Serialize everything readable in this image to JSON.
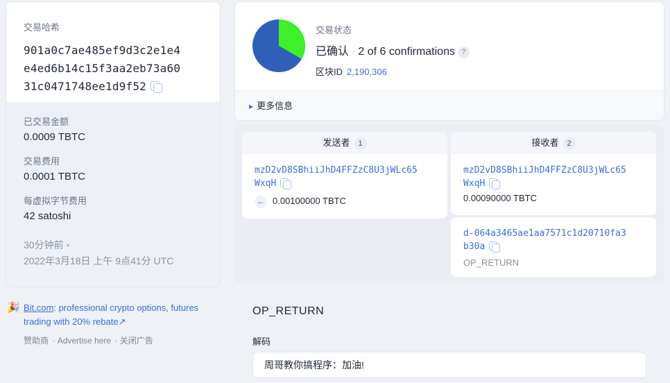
{
  "left": {
    "hash_label": "交易哈希",
    "hash_lines": [
      "901a0c7ae485ef9d3c2e1e4",
      "e4ed6b14c15f3aa2eb73a60",
      "31c0471748ee1d9f52"
    ],
    "traded_amount_label": "已交易金额",
    "traded_amount": "0.0009 TBTC",
    "fee_label": "交易费用",
    "fee": "0.0001 TBTC",
    "vbyte_fee_label": "每虚拟字节费用",
    "vbyte_fee": "42 satoshi",
    "time_ago": "30分钟前",
    "timestamp": "2022年3月18日 上午 9点41分 UTC"
  },
  "ad": {
    "brand_link": "Bit.com",
    "text_1": ": professional crypto options, futures",
    "text_2": "trading with 20% rebate",
    "sponsor": "赞助商",
    "advertise": "Advertise here",
    "close_ad": "关闭广告"
  },
  "status": {
    "label": "交易状态",
    "confirmed": "已确认",
    "confirmations": "2 of 6 confirmations",
    "block_label": "区块ID",
    "block_id": "2,190,306",
    "confirm_fraction": 0.3333,
    "more_info": "更多信息"
  },
  "io": {
    "senders_label": "发送者",
    "senders_count": "1",
    "receivers_label": "接收者",
    "receivers_count": "2",
    "sender": {
      "addr_1": "mzD2vD8SBhiiJhD4FFZzC8U3jWLc65",
      "addr_2": "WxqH",
      "amount": "0.00100000 TBTC"
    },
    "receiver_1": {
      "addr_1": "mzD2vD8SBhiiJhD4FFZzC8U3jWLc65",
      "addr_2": "WxqH",
      "amount": "0.00090000 TBTC"
    },
    "receiver_2": {
      "addr_1": "d-064a3465ae1aa7571c1d20710fa3",
      "addr_2": "b30a",
      "type": "OP_RETURN"
    }
  },
  "op_return": {
    "title": "OP_RETURN",
    "decode_label": "解码",
    "decoded": "周哥教你搞程序：加油!"
  },
  "colors": {
    "accent": "#3b6fd6",
    "pie_confirmed": "#3ef02a",
    "pie_rest": "#2f5fb8"
  }
}
